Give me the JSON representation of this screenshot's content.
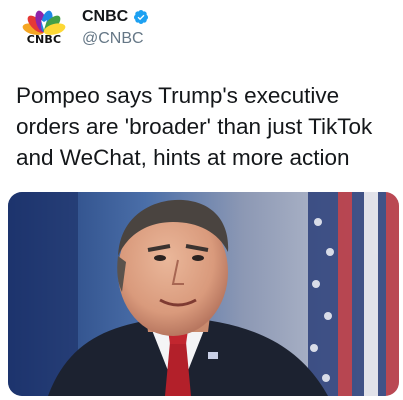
{
  "account": {
    "display_name": "CNBC",
    "handle": "@CNBC",
    "verified": true,
    "logo_text": "CNBC",
    "logo_icon": "nbc-peacock-icon",
    "verified_icon": "verified-badge-icon"
  },
  "tweet": {
    "text": "Pompeo says Trump's executive orders are 'broader' than just TikTok and WeChat, hints at more action"
  },
  "media": {
    "type": "photo",
    "subject": "man-in-suit-with-flag-background"
  },
  "colors": {
    "handle_gray": "#657786",
    "verified_blue": "#1da1f2",
    "text_dark": "#14171a"
  }
}
